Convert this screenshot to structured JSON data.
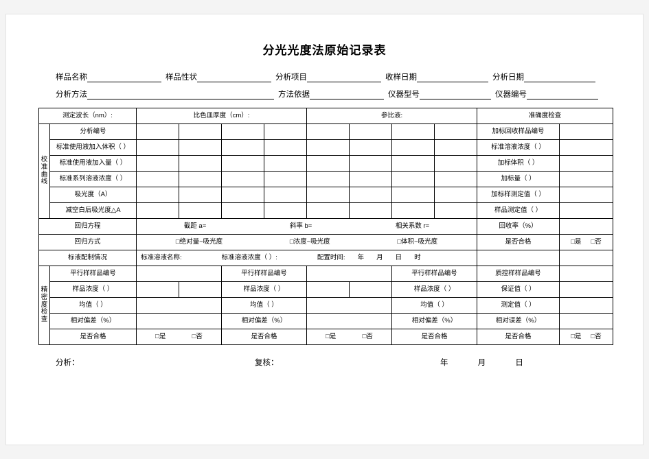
{
  "title": "分光光度法原始记录表",
  "header": {
    "row1": [
      {
        "label": "样品名称",
        "line_width": 108
      },
      {
        "label": "样品性状",
        "line_width": 108
      },
      {
        "label": "分析项目",
        "line_width": 108
      },
      {
        "label": "收样日期",
        "line_width": 104
      },
      {
        "label": "分析日期",
        "line_width": 104
      }
    ],
    "row2": [
      {
        "label": "分析方法",
        "line_width": 272
      },
      {
        "label": "方法依据",
        "line_width": 108
      },
      {
        "label": "仪器型号",
        "line_width": 104
      },
      {
        "label": "仪器编号",
        "line_width": 104
      }
    ]
  },
  "table": {
    "top_row": {
      "wavelength": "测定波长（nm）:",
      "cuvette": "比色皿厚度（cm）:",
      "reference": "参比液:",
      "accuracy_check": "准确度检查"
    },
    "calibration_label": "校准曲线",
    "precision_label": "精密度检查",
    "calibration_rows": [
      {
        "left": "分析编号",
        "right": "加标回收样品编号"
      },
      {
        "left": "标准使用液加入体积（    ）",
        "right": "标准溶液浓度（    ）"
      },
      {
        "left": "标准使用液加入量（    ）",
        "right": "加标体积（   ）"
      },
      {
        "left": "标准系列溶液浓度（    ）",
        "right": "加标量（    ）"
      },
      {
        "left": "吸光度（A）",
        "right": "加标样测定值（    ）"
      },
      {
        "left": "减空白后吸光度△A",
        "right": "样品测定值（    ）"
      }
    ],
    "regression_equation": {
      "label": "回归方程",
      "intercept": "截距 a=",
      "slope": "斜率 b=",
      "correlation": "相关系数 r=",
      "recovery": "回收率（%）",
      "recovery_value": ""
    },
    "regression_mode": {
      "label": "回归方式",
      "options": [
        "□绝对量~吸光度",
        "□浓度~吸光度",
        "□体积~吸光度"
      ],
      "qualified_label": "是否合格",
      "yes": "□是",
      "no": "□否"
    },
    "standard_prep": {
      "label": "标液配制情况",
      "name": "标准溶液名称:",
      "concentration": "标准溶液浓度（   ）:",
      "time": "配置时间:",
      "year": "年",
      "month": "月",
      "day": "日",
      "hour": "时"
    },
    "precision": {
      "groups": [
        {
          "sample_no": "平行样样品编号",
          "concentration": "样品浓度（    ）",
          "mean": "均值（    ）",
          "deviation": "相对偏差（%）",
          "qualified": "是否合格",
          "yes": "□是",
          "no": "□否"
        },
        {
          "sample_no": "平行样样品编号",
          "concentration": "样品浓度（    ）",
          "mean": "均值（    ）",
          "deviation": "相对偏差（%）",
          "qualified": "是否合格",
          "yes": "□是",
          "no": "□否"
        },
        {
          "sample_no": "平行样样品编号",
          "concentration": "样品浓度（    ）",
          "mean": "均值（    ）",
          "deviation": "相对偏差（%）",
          "qualified": "是否合格",
          "yes": "□是",
          "no": "□否"
        },
        {
          "sample_no": "质控样样品编号",
          "concentration": "保证值（    ）",
          "mean": "测定值（    ）",
          "deviation": "相对误差（%）",
          "qualified": "是否合格",
          "yes": "□是",
          "no": "□否"
        }
      ]
    }
  },
  "footer": {
    "analyst": "分析：",
    "reviewer": "复核：",
    "year": "年",
    "month": "月",
    "day": "日"
  }
}
